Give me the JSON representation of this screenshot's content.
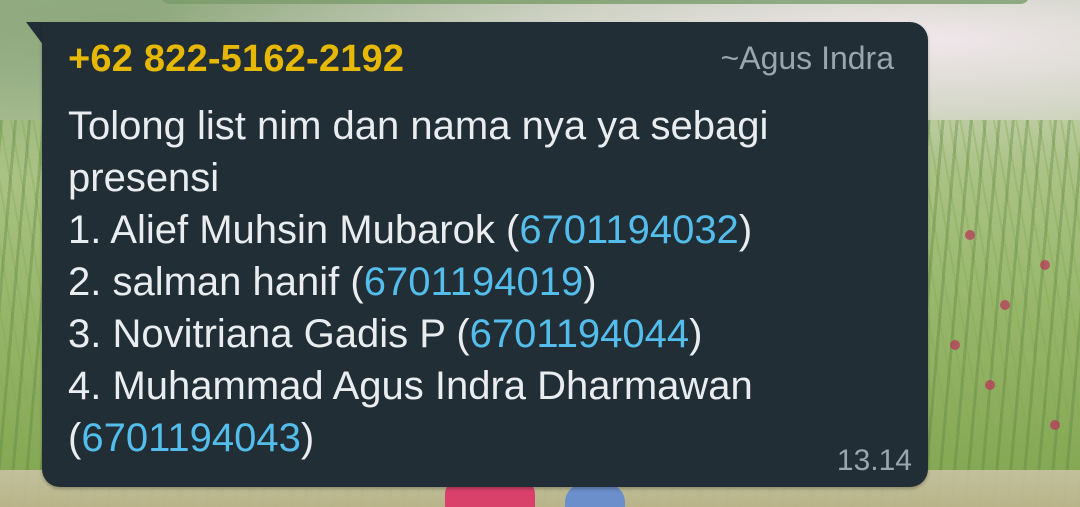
{
  "message": {
    "sender_phone": "+62 822-5162-2192",
    "sender_name": "~Agus Indra",
    "intro_line1": "Tolong list nim dan nama nya ya sebagi",
    "intro_line2": "presensi",
    "entries": [
      {
        "prefix": "1. Alief Muhsin Mubarok (",
        "nim": "6701194032",
        "suffix": ")"
      },
      {
        "prefix": "2. salman hanif (",
        "nim": "6701194019",
        "suffix": ")"
      },
      {
        "prefix": "3.  Novitriana Gadis P (",
        "nim": "6701194044",
        "suffix": ")"
      },
      {
        "prefix": "4. Muhammad Agus Indra Dharmawan",
        "nim": "6701194043",
        "open": "(",
        "suffix": ")"
      }
    ],
    "timestamp": "13.14"
  },
  "colors": {
    "bubble": "#222e35",
    "sender_phone": "#e6b800",
    "link": "#53bdeb",
    "text": "#e9edef",
    "meta": "#9aa6ad"
  }
}
